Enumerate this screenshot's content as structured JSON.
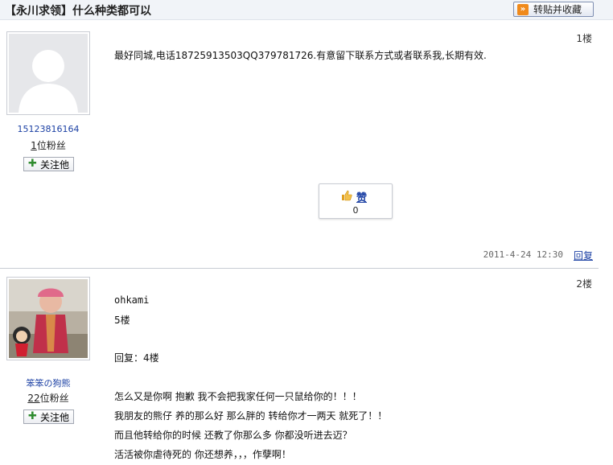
{
  "thread": {
    "title": "【永川求领】什么种类都可以",
    "repost_button": "转贴并收藏"
  },
  "posts": [
    {
      "floor": "1楼",
      "username": "15123816164",
      "fans_count": "1",
      "fans_suffix": "位粉丝",
      "follow_label": "关注他",
      "content": "最好同城,电话18725913503QQ379781726.有意留下联系方式或者联系我,长期有效.",
      "like": {
        "label": "赞",
        "count": "0"
      },
      "timestamp": "2011-4-24 12:30",
      "reply_label": "回复"
    },
    {
      "floor": "2楼",
      "username": "笨笨の狗熊",
      "fans_count": "22",
      "fans_suffix": "位粉丝",
      "follow_label": "关注他",
      "lines": [
        "ohkami",
        "5楼",
        "回复：4楼",
        "怎么又是你啊 抱歉 我不会把我家任何一只鼠给你的！！！",
        "我朋友的熊仔 养的那么好 那么胖的 转给你才一两天 就死了！！",
        "而且他转给你的时候 还教了你那么多 你都没听进去迈？",
        "活活被你虐待死的 你还想养，，，作孽啊！"
      ]
    }
  ],
  "colors": {
    "link": "#1a3fa3",
    "title_bar": "#f1f4f8",
    "follow_plus": "#2e8b2e"
  },
  "icons": {
    "repost": "forward-arrows-icon",
    "follow": "plus-icon",
    "like": "thumbs-up-icon",
    "avatar_default": "default-avatar-silhouette",
    "avatar_photo": "child-photo-avatar"
  }
}
